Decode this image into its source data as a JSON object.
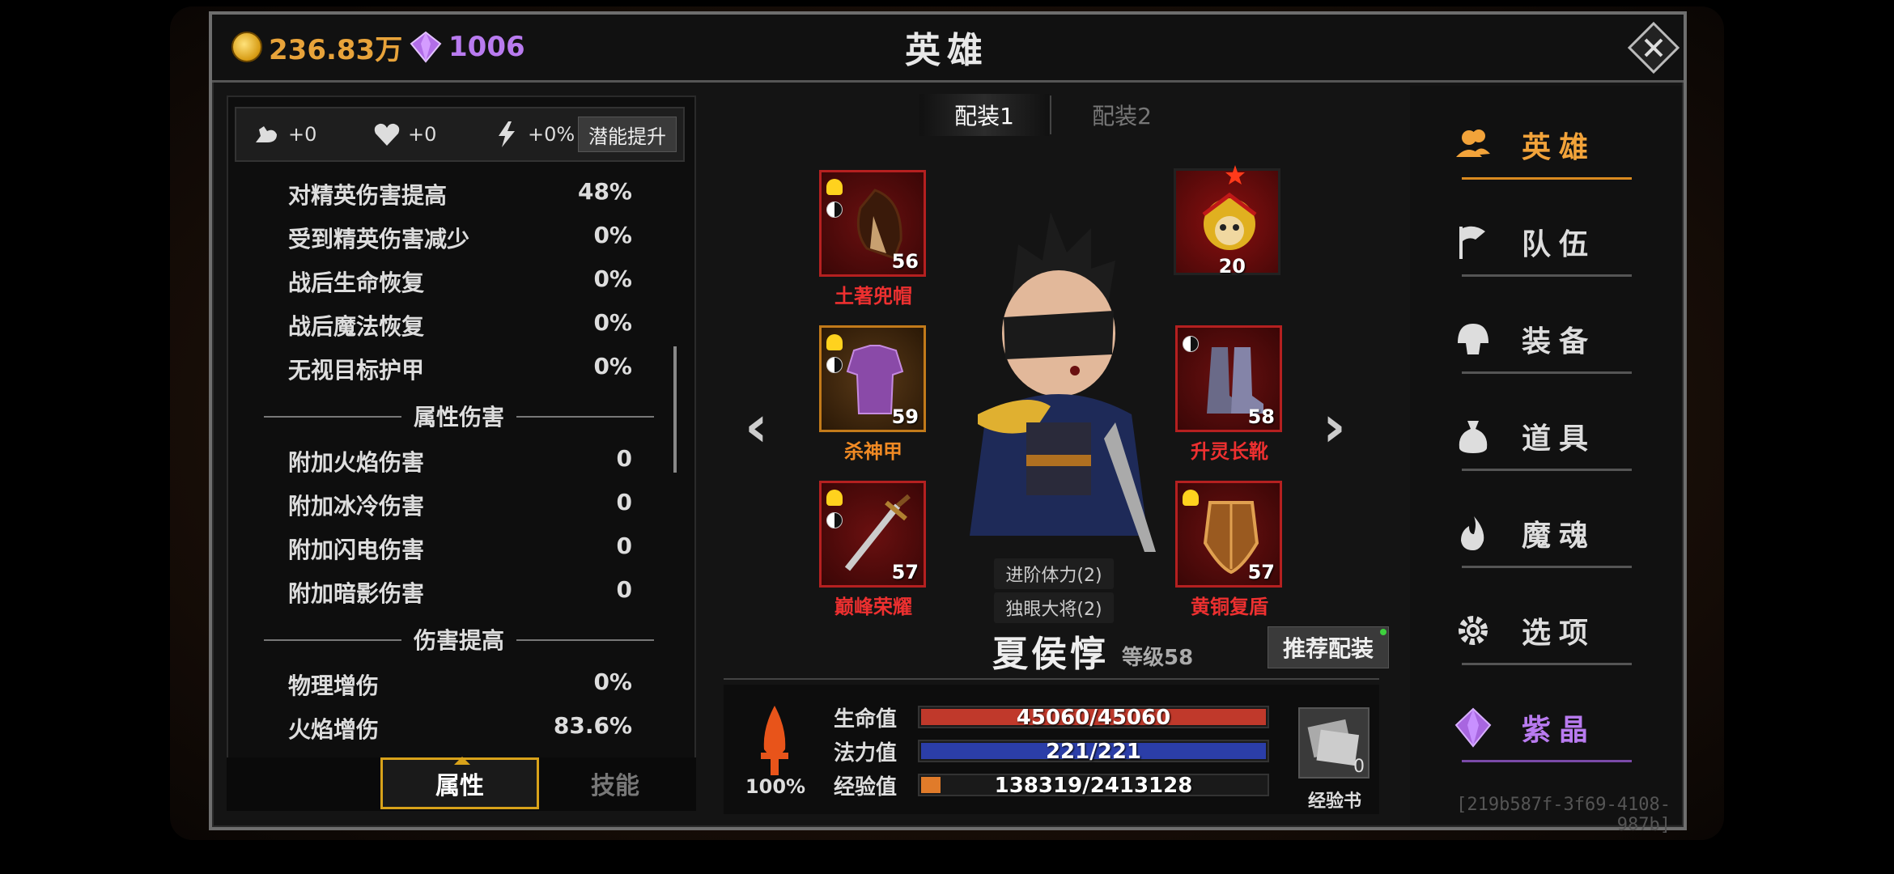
{
  "header": {
    "gold_amount": "236.83万",
    "gem_amount": "1006",
    "title": "英雄"
  },
  "potential": {
    "strength": "+0",
    "health": "+0",
    "speed": "+0%",
    "button": "潜能提升"
  },
  "stats_top": [
    {
      "label": "对精英伤害提高",
      "value": "48%"
    },
    {
      "label": "受到精英伤害减少",
      "value": "0%"
    },
    {
      "label": "战后生命恢复",
      "value": "0%"
    },
    {
      "label": "战后魔法恢复",
      "value": "0%"
    },
    {
      "label": "无视目标护甲",
      "value": "0%"
    }
  ],
  "section_element": "属性伤害",
  "stats_element": [
    {
      "label": "附加火焰伤害",
      "value": "0"
    },
    {
      "label": "附加冰冷伤害",
      "value": "0"
    },
    {
      "label": "附加闪电伤害",
      "value": "0"
    },
    {
      "label": "附加暗影伤害",
      "value": "0"
    }
  ],
  "section_damage": "伤害提高",
  "stats_damage": [
    {
      "label": "物理增伤",
      "value": "0%"
    },
    {
      "label": "火焰增伤",
      "value": "83.6%"
    }
  ],
  "bottom_tabs": {
    "attributes": "属性",
    "skills": "技能"
  },
  "loadouts": {
    "a": "配装1",
    "b": "配装2"
  },
  "equipment": {
    "helmet": {
      "name": "土著兜帽",
      "level": "56"
    },
    "armor": {
      "name": "杀神甲",
      "level": "59"
    },
    "weapon": {
      "name": "巅峰荣耀",
      "level": "57"
    },
    "companion": {
      "level": "20"
    },
    "boots": {
      "name": "升灵长靴",
      "level": "58"
    },
    "shield": {
      "name": "黄铜复盾",
      "level": "57"
    }
  },
  "nav_arrows": {
    "prev": "‹",
    "next": "›"
  },
  "traits": [
    "进阶体力(2)",
    "独眼大将(2)"
  ],
  "hero": {
    "name": "夏侯惇",
    "level": "等级58",
    "recommend": "推荐配装"
  },
  "vitals": {
    "rage_pct": "100%",
    "hp_label": "生命值",
    "hp": "45060/45060",
    "hp_fill": 1.0,
    "mp_label": "法力值",
    "mp": "221/221",
    "mp_fill": 1.0,
    "xp_label": "经验值",
    "xp": "138319/2413128",
    "xp_fill": 0.057,
    "xp_book_label": "经验书",
    "xp_book_count": "0"
  },
  "right_nav": [
    "英雄",
    "队伍",
    "装备",
    "道具",
    "魔魂",
    "选项",
    "紫晶"
  ],
  "uuid": "[219b587f-3f69-4108-987b]",
  "colors": {
    "gold": "#e8a33a",
    "purple": "#b97bf0",
    "accent": "#f2a33a",
    "hp": "#c0392b",
    "mp": "#2b3ea8",
    "xp": "#e07b2a"
  }
}
